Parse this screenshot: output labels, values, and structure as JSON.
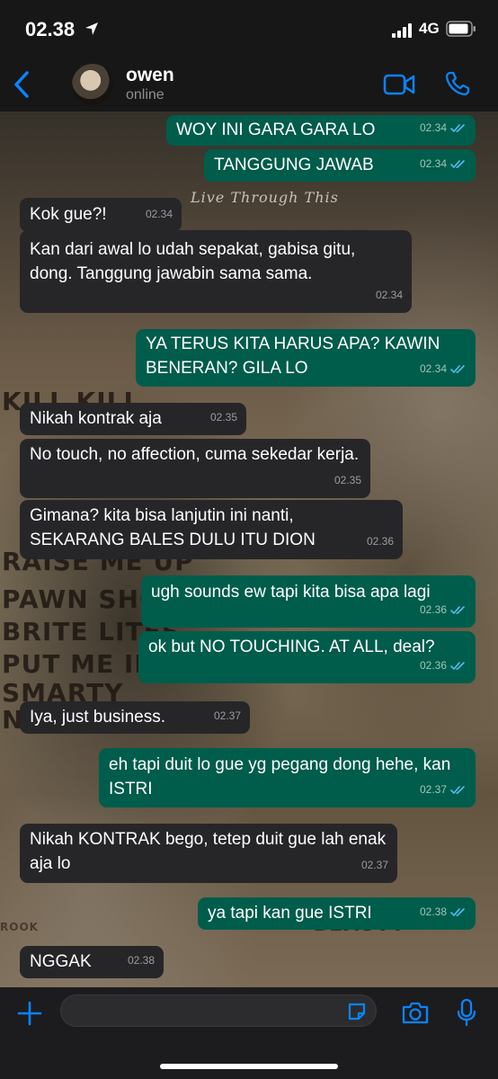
{
  "status_bar": {
    "time": "02.38",
    "network": "4G"
  },
  "header": {
    "name": "owen",
    "status": "online"
  },
  "background_words": [
    "Live Through This",
    "KILL KILL",
    "RAISE ME UP",
    "PAWN SHOP BLU",
    "BRITE LITES",
    "PUT ME IN A MOV",
    "SMARTY",
    "NO...",
    "BEAUTY",
    "ROOK"
  ],
  "messages": [
    {
      "dir": "out",
      "text": "WOY INI GARA GARA LO",
      "time": "02.34"
    },
    {
      "dir": "out",
      "text": "TANGGUNG JAWAB",
      "time": "02.34"
    },
    {
      "dir": "in",
      "text": "Kok gue?!",
      "time": "02.34"
    },
    {
      "dir": "in",
      "text": "Kan dari awal lo udah sepakat, gabisa gitu, dong. Tanggung jawabin sama sama.",
      "time": "02.34"
    },
    {
      "dir": "out",
      "text": "YA TERUS KITA HARUS APA? KAWIN BENERAN? GILA LO",
      "time": "02.34"
    },
    {
      "dir": "in",
      "text": "Nikah kontrak aja",
      "time": "02.35"
    },
    {
      "dir": "in",
      "text": "No touch, no affection, cuma sekedar kerja.",
      "time": "02.35"
    },
    {
      "dir": "in",
      "text": "Gimana? kita bisa lanjutin ini nanti, SEKARANG BALES DULU ITU DION",
      "time": "02.36"
    },
    {
      "dir": "out",
      "text": "ugh sounds ew tapi kita bisa apa lagi",
      "time": "02.36"
    },
    {
      "dir": "out",
      "text": "ok but NO TOUCHING. AT ALL, deal?",
      "time": "02.36"
    },
    {
      "dir": "in",
      "text": "Iya, just business.",
      "time": "02.37"
    },
    {
      "dir": "out",
      "text": "eh tapi duit lo gue yg pegang dong hehe, kan ISTRI",
      "time": "02.37"
    },
    {
      "dir": "in",
      "text": "Nikah KONTRAK bego, tetep duit gue lah enak aja lo",
      "time": "02.37"
    },
    {
      "dir": "out",
      "text": "ya tapi kan gue ISTRI",
      "time": "02.38"
    },
    {
      "dir": "in",
      "text": "NGGAK",
      "time": "02.38"
    }
  ],
  "composer": {
    "placeholder": ""
  },
  "colors": {
    "incoming_bubble": "#262628",
    "outgoing_bubble": "#005c4b",
    "accent": "#0a84ff",
    "read_ticks": "#53bdeb"
  },
  "icons": [
    "location-arrow-icon",
    "signal-icon",
    "battery-icon",
    "back-chevron-icon",
    "video-call-icon",
    "phone-icon",
    "double-check-icon",
    "plus-icon",
    "sticker-icon",
    "camera-icon",
    "mic-icon"
  ]
}
